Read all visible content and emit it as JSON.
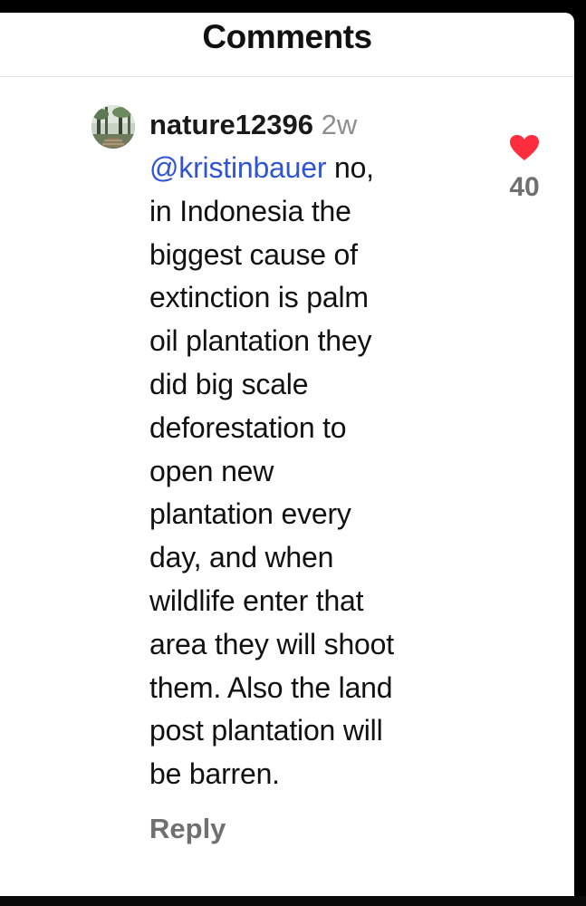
{
  "header": {
    "title": "Comments"
  },
  "comment": {
    "avatar_icon": "nature-forest-avatar",
    "username": "nature12396",
    "time": "2w",
    "mention": "@kristinbauer",
    "lines": [
      " no,",
      "in Indonesia the",
      "biggest cause of",
      "extinction is palm",
      "oil plantation they",
      "did big scale",
      "deforestation to",
      "open new",
      "plantation every",
      "day, and when",
      "wildlife enter that",
      "area they will shoot",
      "them. Also the land",
      "post plantation will",
      "be barren."
    ],
    "reply_label": "Reply",
    "like_icon": "heart-icon",
    "like_count": "40",
    "like_color": "#ff2d3d"
  }
}
